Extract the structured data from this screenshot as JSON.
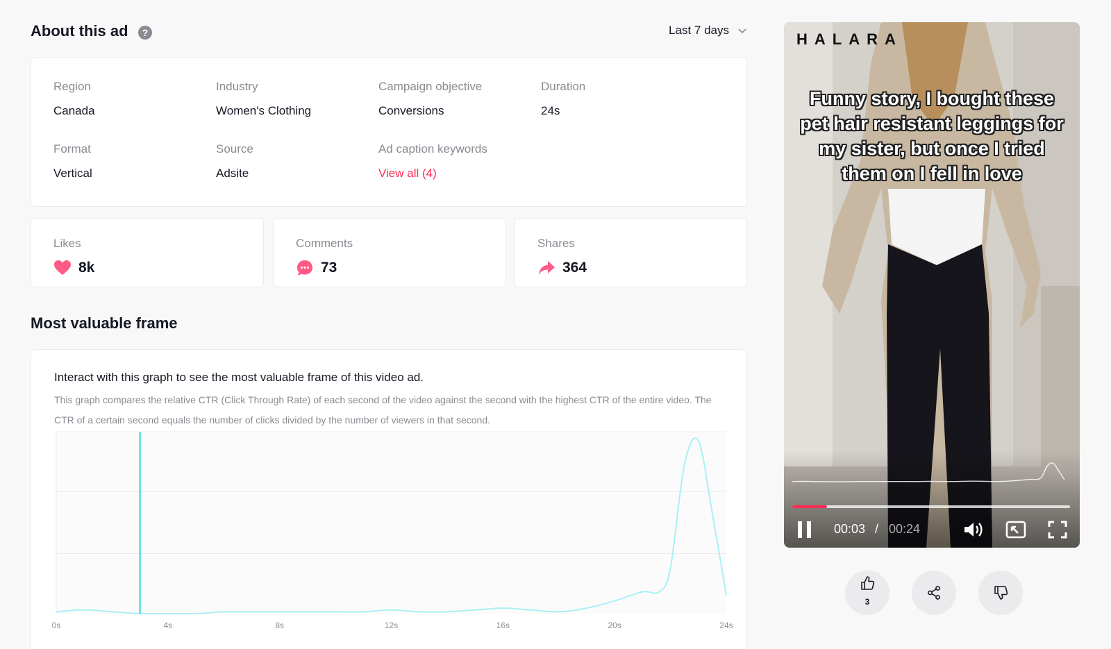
{
  "about": {
    "title": "About this ad",
    "help_icon": "question-circle-icon",
    "date_range": "Last 7 days"
  },
  "info": {
    "region": {
      "label": "Region",
      "value": "Canada"
    },
    "industry": {
      "label": "Industry",
      "value": "Women's Clothing"
    },
    "objective": {
      "label": "Campaign objective",
      "value": "Conversions"
    },
    "duration": {
      "label": "Duration",
      "value": "24s"
    },
    "format": {
      "label": "Format",
      "value": "Vertical"
    },
    "source": {
      "label": "Source",
      "value": "Adsite"
    },
    "keywords": {
      "label": "Ad caption keywords",
      "value": "View all (4)"
    }
  },
  "stats": {
    "likes": {
      "label": "Likes",
      "value": "8k",
      "icon": "heart-icon"
    },
    "comments": {
      "label": "Comments",
      "value": "73",
      "icon": "comment-bubble-icon"
    },
    "shares": {
      "label": "Shares",
      "value": "364",
      "icon": "share-arrow-icon"
    }
  },
  "frame": {
    "title": "Most valuable frame",
    "heading": "Interact with this graph to see the most valuable frame of this video ad.",
    "description": "This graph compares the relative CTR (Click Through Rate) of each second of the video against the second with the highest CTR of the entire video. The CTR of a certain second equals the number of clicks divided by the number of viewers in that second."
  },
  "chart_data": {
    "type": "line",
    "xlabel": "",
    "ylabel": "",
    "x_ticks": [
      "0s",
      "4s",
      "8s",
      "12s",
      "16s",
      "20s",
      "24s"
    ],
    "xlim": [
      0,
      24
    ],
    "ylim": [
      0,
      1
    ],
    "grid": true,
    "cursor_x": 3,
    "series": [
      {
        "color": "#a9f0f4",
        "x": [
          0,
          1,
          2,
          3,
          4,
          5,
          6,
          7,
          8,
          9,
          10,
          11,
          12,
          13,
          14,
          15,
          16,
          17,
          18,
          19,
          20,
          21,
          21.6,
          22,
          22.5,
          23,
          23.5,
          24
        ],
        "y": [
          0.01,
          0.02,
          0.01,
          0.0,
          0.0,
          0.0,
          0.01,
          0.01,
          0.01,
          0.01,
          0.01,
          0.01,
          0.02,
          0.01,
          0.01,
          0.02,
          0.03,
          0.02,
          0.01,
          0.03,
          0.07,
          0.12,
          0.12,
          0.25,
          0.82,
          0.95,
          0.55,
          0.1
        ]
      }
    ]
  },
  "video": {
    "brand": "HALARA",
    "caption": "Funny story, I bought these pet hair resistant leggings for my sister, but once I tried them on I fell in love",
    "progress": 0.125,
    "time_current": "00:03",
    "time_separator": "/",
    "time_total": "00:24"
  },
  "actions": {
    "like_count": "3"
  },
  "colors": {
    "accent": "#fe2c55",
    "chart_line": "#a9f0f4",
    "cursor_line": "#25d9d9",
    "stat_icon": "#fe5b86"
  }
}
